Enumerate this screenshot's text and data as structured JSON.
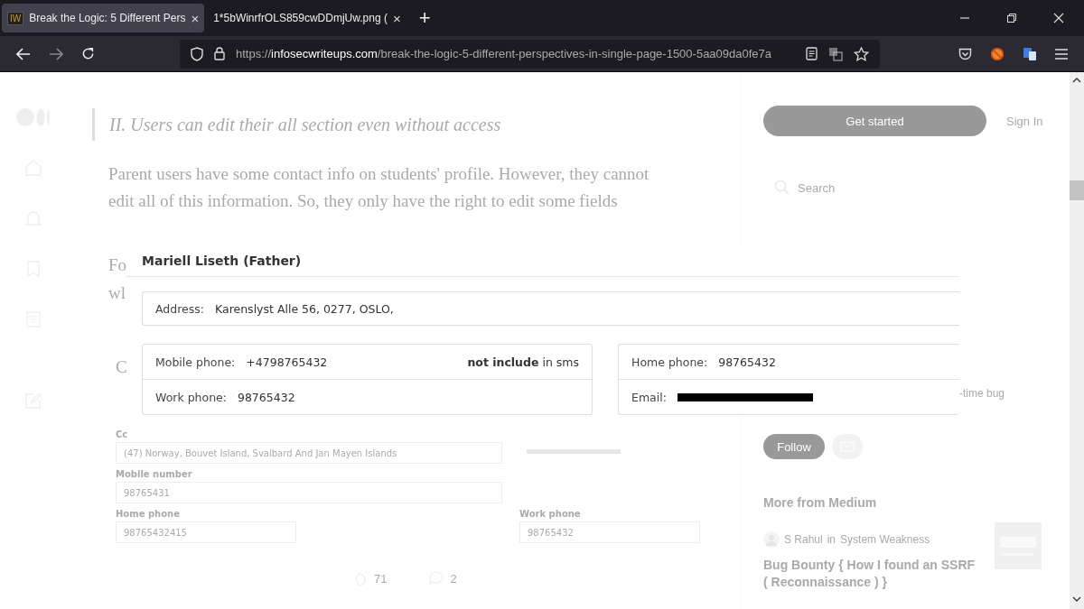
{
  "browser": {
    "tabs": [
      {
        "favicon": "IW",
        "title": "Break the Logic: 5 Different Pers",
        "close": "×",
        "selected": true
      },
      {
        "title": "1*5bWinrfrOLS859cwDDmjUw.png (",
        "close": "×",
        "selected": false
      }
    ],
    "new_tab": "+",
    "url": {
      "prefix": "https://",
      "domain": "infosecwriteups.com",
      "path": "/break-the-logic-5-different-perspectives-in-single-page-1500-5aa09da0fe7a"
    }
  },
  "article": {
    "heading": "II. Users can edit their all section even without access",
    "paragraph": "Parent users have some contact info on students' profile. However, they cannot edit all of this information. So, they only have the right to edit some fields",
    "fragments": [
      "Fo",
      "wl",
      "C"
    ],
    "claps": "71",
    "comments": "2"
  },
  "sidebar": {
    "get_started": "Get started",
    "sign_in": "Sign In",
    "search_placeholder": "Search",
    "fragment": "-time bug",
    "follow": "Follow",
    "more_heading": "More from Medium",
    "story": {
      "author": "S Rahul",
      "in": "in",
      "publication": "System Weakness",
      "title": "Bug Bounty { How I found an SSRF ( Reconnaissance ) }"
    }
  },
  "screenshot": {
    "name": "Mariell Liseth (Father)",
    "address": {
      "label": "Address:",
      "value": "Karenslyst Alle 56, 0277, OSLO,"
    },
    "left_rows": [
      {
        "label": "Mobile phone:",
        "value": "+4798765432",
        "note": "**not include** in sms"
      },
      {
        "label": "Work phone:",
        "value": "98765432"
      }
    ],
    "right_rows": [
      {
        "label": "Home phone:",
        "value": "98765432",
        "redacted": false
      },
      {
        "label": "Email:",
        "redacted": true
      }
    ],
    "form": {
      "cc_label": "Cc",
      "email_redacted": true,
      "country": "(47) Norway, Bouvet Island, Svalbard And Jan Mayen Islands",
      "fields": [
        {
          "label": "Mobile number",
          "value": "98765431"
        },
        {
          "label": "Home phone",
          "value": "98765432415"
        },
        {
          "label": "Work phone",
          "value": "98765432"
        }
      ]
    }
  }
}
